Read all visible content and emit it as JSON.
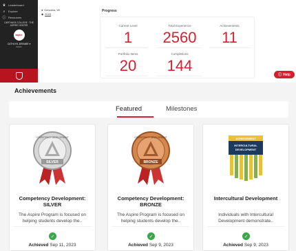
{
  "sidebar": {
    "items": [
      {
        "label": "Leaderboard",
        "icon": "trophy-icon"
      },
      {
        "label": "Explore",
        "icon": "search-icon"
      },
      {
        "label": "Resources",
        "icon": "info-icon"
      }
    ],
    "org": "CARTHAGE COLLEGE · THE ASPIRE CENTER",
    "logo_text": "aspire",
    "user": "CATHLYN JERAIME",
    "role": "Admin"
  },
  "profile": {
    "location": "Kenosha, WI",
    "year": "2025"
  },
  "progress": {
    "title": "Progress",
    "stats": [
      {
        "label": "Current Level",
        "value": "1"
      },
      {
        "label": "Total Experience",
        "value": "2560"
      },
      {
        "label": "Achievements",
        "value": "11"
      },
      {
        "label": "Portfolio Items",
        "value": "20"
      },
      {
        "label": "Completions",
        "value": "144"
      }
    ]
  },
  "help": {
    "label": "Help"
  },
  "achievements": {
    "heading": "Achievements",
    "tabs": [
      {
        "label": "Featured",
        "active": true
      },
      {
        "label": "Milestones",
        "active": false
      }
    ],
    "cards": [
      {
        "title": "Competency Development: SILVER",
        "desc": "The Aspire Program is focused on helping students develop the..",
        "achieved_label": "Achieved",
        "date": "Sep 11, 2023",
        "badge_text": "SILVER",
        "badge_arc": "COMPETENCY DEVELOPMENT",
        "badge_color": "#b8b8b8"
      },
      {
        "title": "Competency Development: BRONZE",
        "desc": "The Aspire Program is focused on helping students develop the..",
        "achieved_label": "Achieved",
        "date": "Sep 9, 2023",
        "badge_text": "BRONZE",
        "badge_arc": "COMPETENCY DEVELOPMENT",
        "badge_color": "#c86c3c"
      },
      {
        "title": "Intercultural Development",
        "desc": "Individuals with Intercultural Development demonstrate..",
        "achieved_label": "Achieved",
        "date": "Sep 9, 2023",
        "badge_text": "INTERCULTURAL DEVELOPMENT",
        "badge_arc": "ACHIEVEMENT",
        "badge_color": "#1c3a5e"
      }
    ]
  },
  "colors": {
    "accent": "#d1202f",
    "success": "#3aa64c",
    "sidebar_bg": "#222222"
  }
}
